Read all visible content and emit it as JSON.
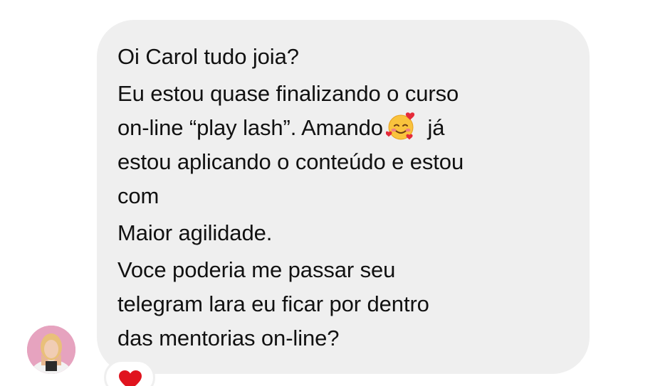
{
  "message": {
    "lines": [
      "Oi Carol tudo joia?",
      "Eu estou quase finalizando o curso",
      "on-line “play lash”. Amando",
      " já",
      "estou aplicando o conteúdo e estou",
      "com",
      "Maior agilidade.",
      "Voce poderia me passar seu",
      "telegram lara eu ficar por dentro",
      "das mentorias on-line?"
    ],
    "emoji": "smiling-face-with-hearts-icon",
    "bubble_color": "#efefef"
  },
  "reaction": {
    "icon": "red-heart-icon",
    "color": "#e0141e"
  },
  "sender": {
    "avatar": "avatar"
  }
}
